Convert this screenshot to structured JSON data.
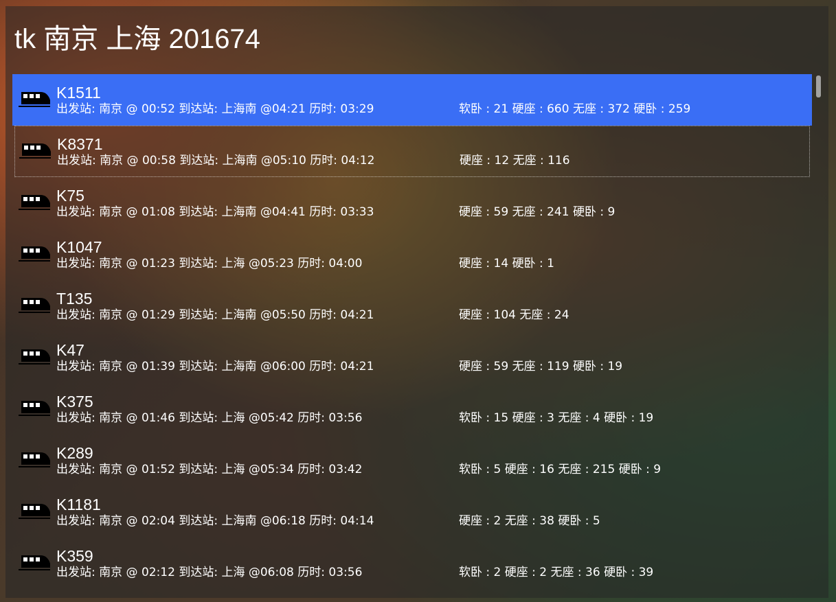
{
  "window": {
    "title": "tk 南京 上海 201674"
  },
  "trains": [
    {
      "number": "K1511",
      "route": "出发站: 南京 @ 00:52  到达站: 上海南  @04:21  历时: 03:29",
      "seats": "软卧 : 21  硬座 : 660  无座 : 372  硬卧 : 259"
    },
    {
      "number": "K8371",
      "route": "出发站: 南京 @ 00:58  到达站: 上海南  @05:10  历时: 04:12",
      "seats": "硬座 : 12  无座 : 116"
    },
    {
      "number": "K75",
      "route": "出发站: 南京 @ 01:08  到达站: 上海南  @04:41  历时: 03:33",
      "seats": "硬座 : 59  无座 : 241  硬卧 : 9"
    },
    {
      "number": "K1047",
      "route": "出发站: 南京 @ 01:23  到达站: 上海  @05:23  历时: 04:00",
      "seats": "硬座 : 14  硬卧 : 1"
    },
    {
      "number": "T135",
      "route": "出发站: 南京 @ 01:29  到达站: 上海南  @05:50  历时: 04:21",
      "seats": "硬座 : 104  无座 : 24"
    },
    {
      "number": "K47",
      "route": "出发站: 南京 @ 01:39  到达站: 上海南  @06:00  历时: 04:21",
      "seats": "硬座 : 59  无座 : 119  硬卧 : 19"
    },
    {
      "number": "K375",
      "route": "出发站: 南京 @ 01:46  到达站: 上海  @05:42  历时: 03:56",
      "seats": "软卧 : 15  硬座 : 3  无座 : 4  硬卧 : 19"
    },
    {
      "number": "K289",
      "route": "出发站: 南京 @ 01:52  到达站: 上海  @05:34  历时: 03:42",
      "seats": "软卧 : 5  硬座 : 16  无座 : 215  硬卧 : 9"
    },
    {
      "number": "K1181",
      "route": "出发站: 南京 @ 02:04  到达站: 上海南  @06:18  历时: 04:14",
      "seats": "硬座 : 2  无座 : 38  硬卧 : 5"
    },
    {
      "number": "K359",
      "route": "出发站: 南京 @ 02:12  到达站: 上海  @06:08  历时: 03:56",
      "seats": "软卧 : 2  硬座 : 2  无座 : 36  硬卧 : 39"
    }
  ],
  "icons": {
    "row_icon": "train-icon"
  },
  "colors": {
    "selection": "#3a6ef5",
    "text": "#ffffff"
  }
}
